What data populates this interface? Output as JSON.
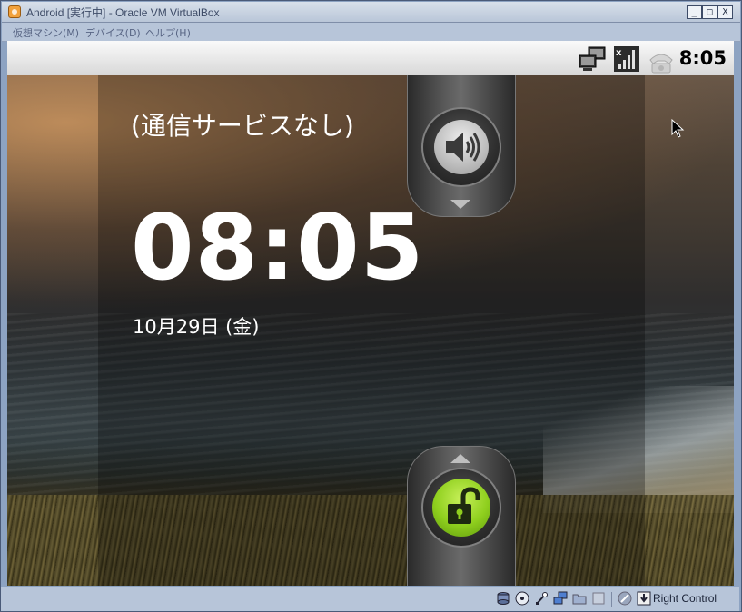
{
  "window": {
    "title": "Android [実行中] - Oracle VM VirtualBox",
    "buttons": [
      "_",
      "□",
      "X"
    ]
  },
  "menu": {
    "items": [
      "仮想マシン(M)",
      "デバイス(D)",
      "ヘルプ(H)"
    ]
  },
  "android": {
    "status_time": "8:05",
    "status_icons": [
      "network-icon",
      "no-signal-icon",
      "phone-icon"
    ],
    "carrier_text": "(通信サービスなし)",
    "clock": "08:05",
    "date": "10月29日 (金)",
    "sound_icon": "speaker-icon",
    "lock_icon": "unlock-icon",
    "accent_lock": "#8fcf1e"
  },
  "vbox_status": {
    "icons": [
      "hdd-icon",
      "cd-icon",
      "usb-icon",
      "network-icon",
      "shared-folder-icon",
      "display-icon",
      "mouse-integration-icon",
      "host-key-icon"
    ],
    "host_key_label": "Right Control"
  }
}
